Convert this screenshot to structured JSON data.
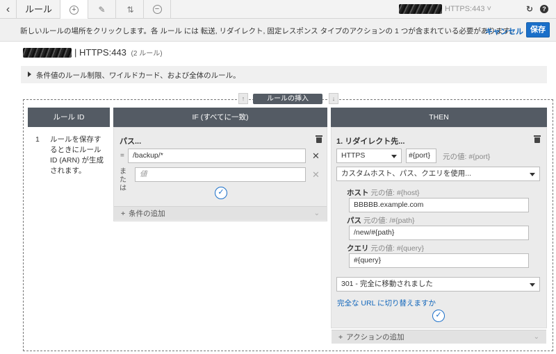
{
  "topbar": {
    "title": "ルール",
    "listener": "HTTPS:443 ˅"
  },
  "notice": {
    "text": "新しいルールの場所をクリックします。各 ルール には 転送, リダイレクト, 固定レスポンス タイプのアクションの 1 つが含まれている必要があります。",
    "cancel_label": "キャンセル",
    "save_label": "保存"
  },
  "heading": {
    "title": "| HTTPS:443",
    "count": "(2 ルール)"
  },
  "info_bar": {
    "text": "条件値のルール制限、ワイルドカード、および全体のルール。"
  },
  "insert": {
    "label": "ルールの挿入"
  },
  "columns": {
    "rule_id": "ルール ID",
    "if": "IF (すべてに一致)",
    "then": "THEN"
  },
  "rule": {
    "number": "1",
    "note": "ルールを保存するときにルール ID (ARN) が生成されます。"
  },
  "if_panel": {
    "title": "パス...",
    "op_equals": "=",
    "path_value": "/backup/*",
    "op_or": "または",
    "value_placeholder": "値",
    "add_condition": "条件の追加"
  },
  "then_panel": {
    "title": "1. リダイレクト先...",
    "protocol": "HTTPS",
    "port": "#{port}",
    "port_orig": "元の値: #{port}",
    "mode": "カスタムホスト、パス、クエリを使用...",
    "host_label": "ホスト",
    "host_orig": "元の値: #{host}",
    "host_value": "BBBBB.example.com",
    "path_label": "パス",
    "path_orig": "元の値: /#{path}",
    "path_value": "/new/#{path}",
    "query_label": "クエリ",
    "query_orig": "元の値: #{query}",
    "query_value": "#{query}",
    "status": "301 - 完全に移動されました",
    "full_url_link": "完全な URL に切り替えますか",
    "add_action": "アクションの追加"
  }
}
